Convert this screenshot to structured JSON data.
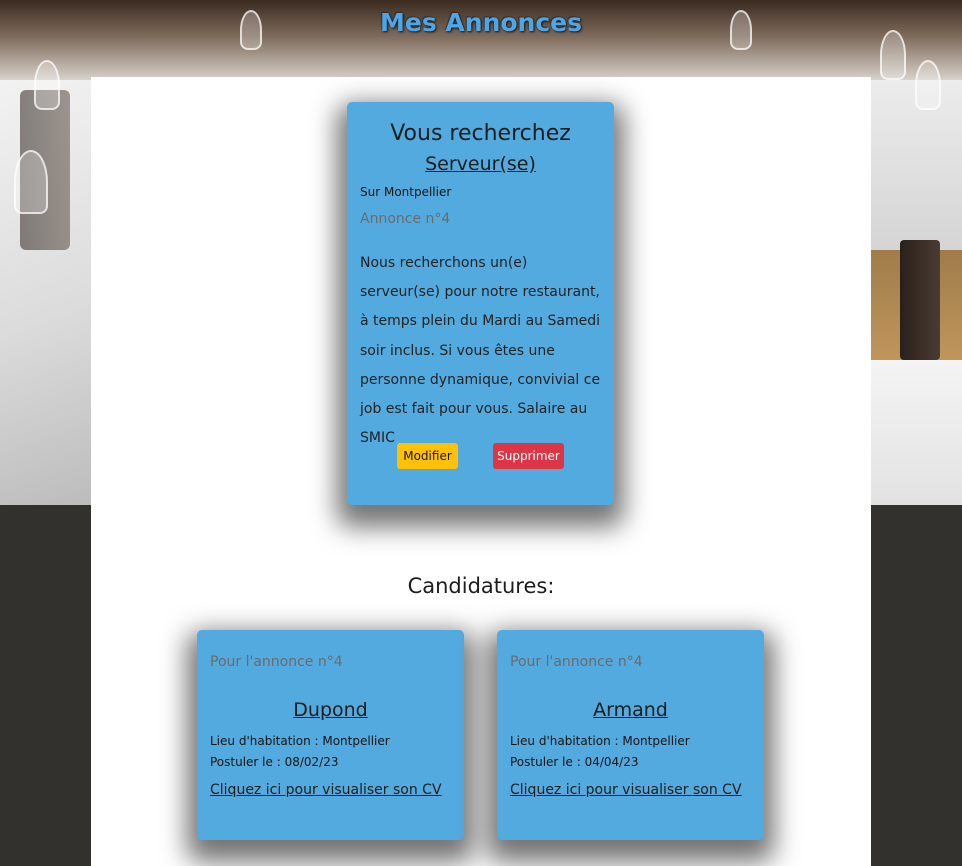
{
  "page": {
    "title": "Mes Annonces"
  },
  "offer": {
    "heading": "Vous recherchez",
    "job_title": "Serveur(se)",
    "location": "Sur Montpellier",
    "number": "Annonce n°4",
    "description": "Nous recherchons un(e) serveur(se) pour notre restaurant, à temps plein du Mardi au Samedi soir inclus. Si vous êtes une personne dynamique, convivial ce job est fait pour vous. Salaire au SMIC",
    "edit_label": "Modifier",
    "delete_label": "Supprimer"
  },
  "applications": {
    "title": "Candidatures:",
    "items": [
      {
        "reference": "Pour l'annonce n°4",
        "name": "Dupond",
        "residence": "Lieu d'habitation : Montpellier",
        "applied_on": "Postuler le : 08/02/23",
        "cv_link": "Cliquez ici pour visualiser son CV"
      },
      {
        "reference": "Pour l'annonce n°4",
        "name": "Armand",
        "residence": "Lieu d'habitation : Montpellier",
        "applied_on": "Postuler le : 04/04/23",
        "cv_link": "Cliquez ici pour visualiser son CV"
      }
    ]
  },
  "colors": {
    "card_background": "#53aadf",
    "title_color": "#4da6e8",
    "edit_button": "#ffc107",
    "delete_button": "#dc3545",
    "page_background": "#33312e"
  }
}
